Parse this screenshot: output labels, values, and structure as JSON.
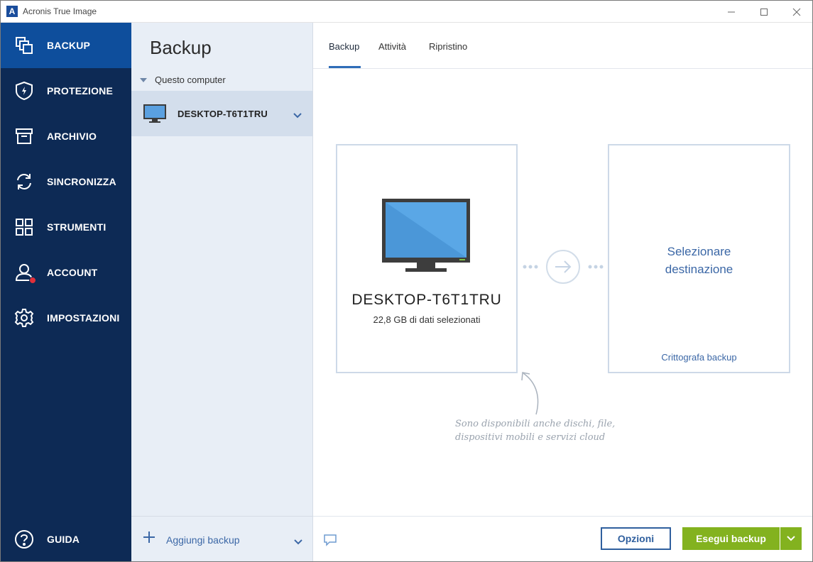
{
  "window": {
    "title": "Acronis True Image",
    "logo_letter": "A"
  },
  "nav": {
    "items": [
      {
        "label": "BACKUP"
      },
      {
        "label": "PROTEZIONE"
      },
      {
        "label": "ARCHIVIO"
      },
      {
        "label": "SINCRONIZZA"
      },
      {
        "label": "STRUMENTI"
      },
      {
        "label": "ACCOUNT"
      },
      {
        "label": "IMPOSTAZIONI"
      }
    ],
    "help_label": "GUIDA"
  },
  "panel": {
    "title": "Backup",
    "section": "Questo computer",
    "source_name": "DESKTOP-T6T1TRU",
    "add_label": "Aggiungi backup"
  },
  "tabs": [
    "Backup",
    "Attività",
    "Ripristino"
  ],
  "source_card": {
    "name": "DESKTOP-T6T1TRU",
    "subtitle": "22,8 GB di dati selezionati"
  },
  "dest_card": {
    "title_line1": "Selezionare",
    "title_line2": "destinazione",
    "link": "Crittografa backup"
  },
  "hint": {
    "line1": "Sono disponibili anche dischi, file,",
    "line2": "dispositivi mobili e servizi cloud"
  },
  "footer": {
    "options_label": "Opzioni",
    "run_label": "Esegui backup"
  },
  "colors": {
    "nav_bg": "#0d2a55",
    "nav_active": "#0e4e9c",
    "accent": "#3b67a6",
    "run_button": "#83b21f",
    "badge": "#e0303a"
  }
}
